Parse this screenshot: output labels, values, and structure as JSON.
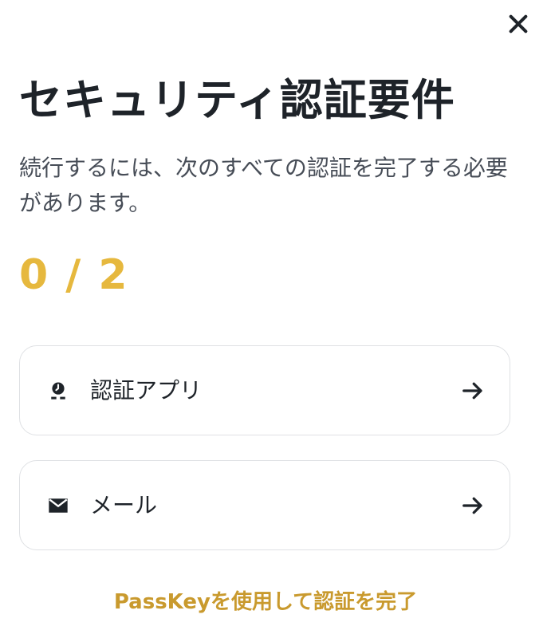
{
  "header": {
    "close_icon": "close-icon"
  },
  "page": {
    "title": "セキュリティ認証要件",
    "subtitle": "続行するには、次のすべての認証を完了する必要があります。",
    "progress": "0 / 2"
  },
  "methods": [
    {
      "label": "認証アプリ",
      "icon": "authenticator-app-icon",
      "action_icon": "arrow-right-icon"
    },
    {
      "label": "メール",
      "icon": "email-icon",
      "action_icon": "arrow-right-icon"
    }
  ],
  "footer": {
    "passkey_link": "PassKeyを使用して認証を完了"
  },
  "colors": {
    "text_primary": "#1e2329",
    "text_secondary": "#474d57",
    "progress": "#e6b83e",
    "link": "#c99a2e",
    "card_border": "#dfe1e4"
  }
}
